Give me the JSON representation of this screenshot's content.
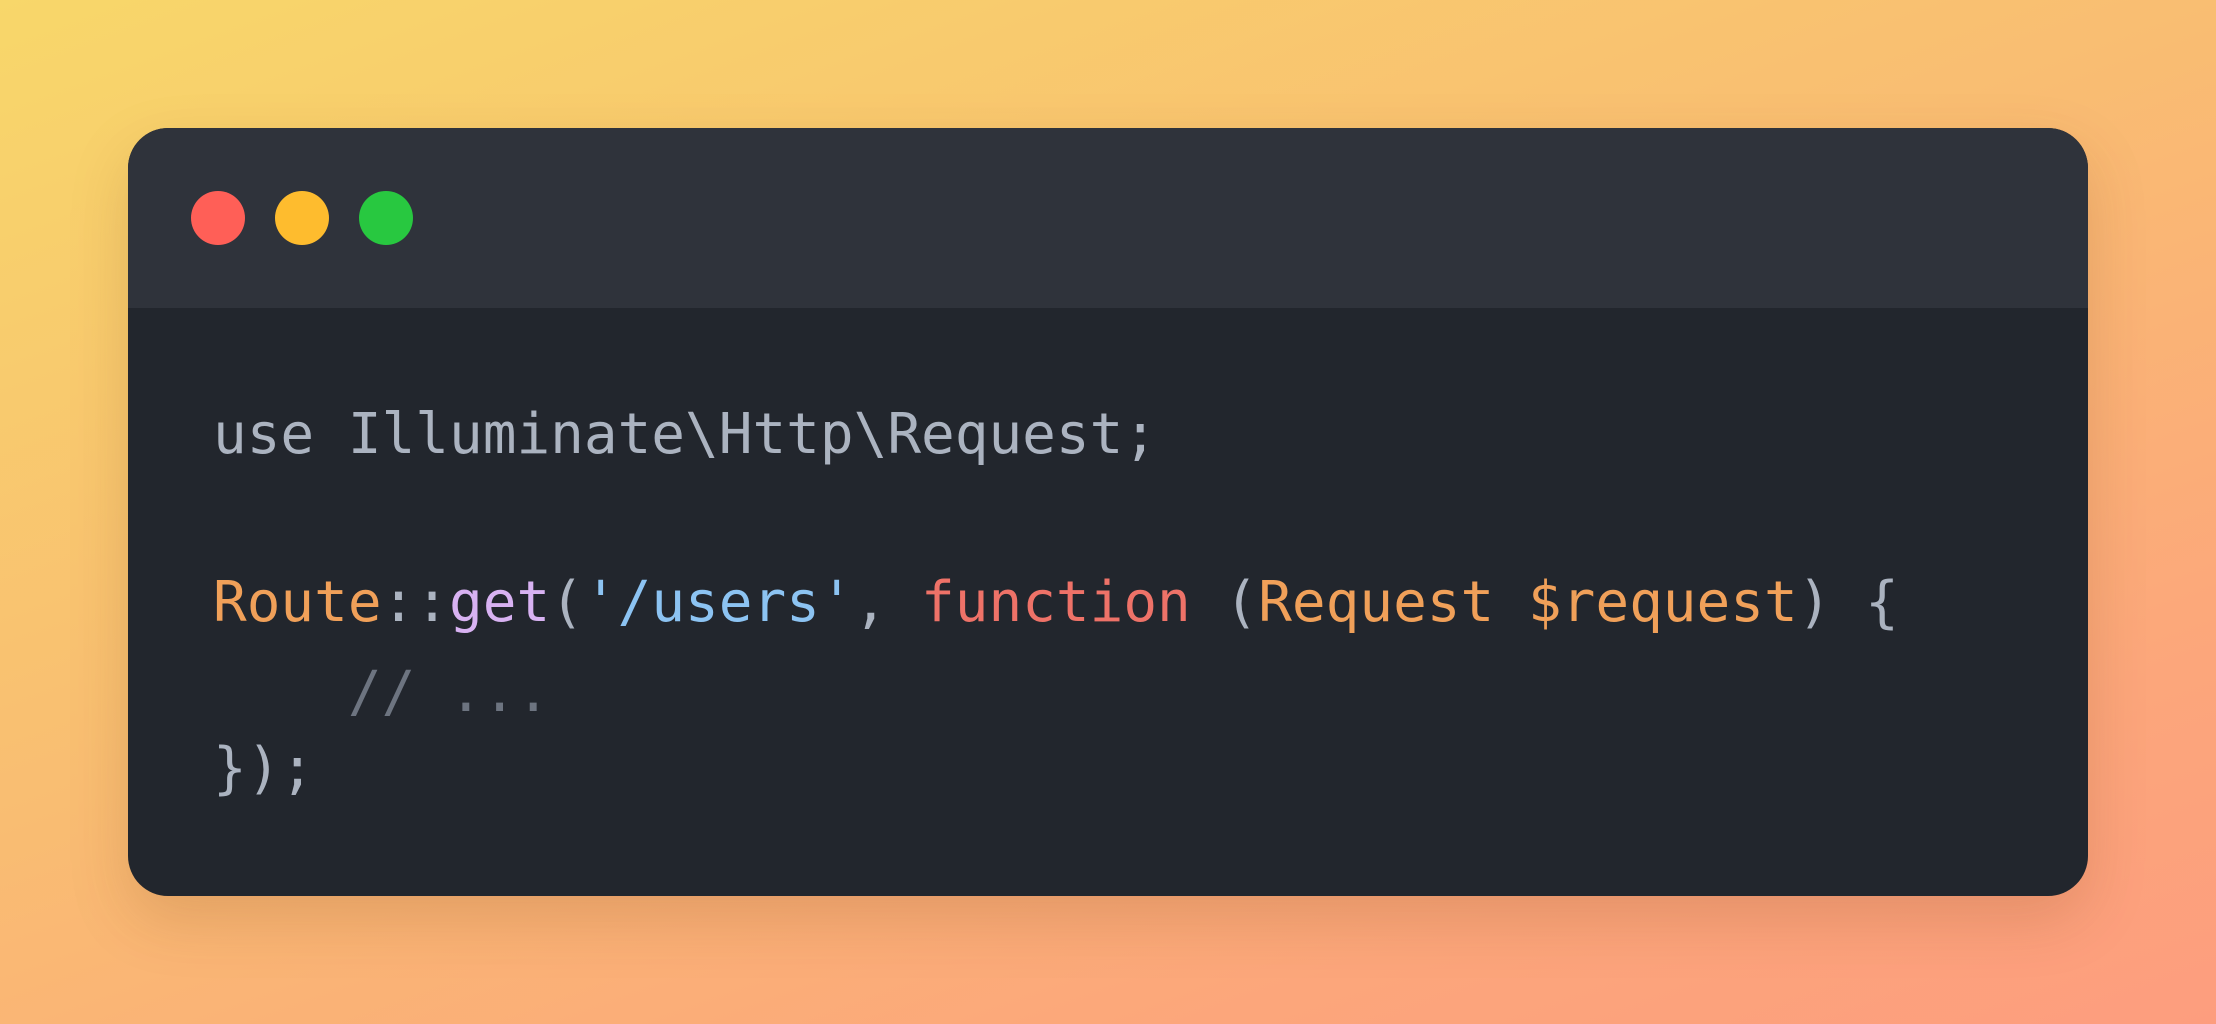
{
  "window": {
    "controls": [
      {
        "name": "close",
        "color": "#ff5f57"
      },
      {
        "name": "minimize",
        "color": "#febc2e"
      },
      {
        "name": "maximize",
        "color": "#28c840"
      }
    ]
  },
  "code": {
    "line1": {
      "kw_use": "use",
      "space": " ",
      "namespace": "Illuminate\\Http\\Request",
      "semicolon": ";"
    },
    "line3": {
      "class": "Route",
      "scope": "::",
      "method": "get",
      "paren_open": "(",
      "string": "'/users'",
      "comma": ", ",
      "kw_function": "function",
      "space": " ",
      "paren_open2": "(",
      "type": "Request",
      "space2": " ",
      "var": "$request",
      "paren_close": ")",
      "brace": " {"
    },
    "line4": {
      "indent": "    ",
      "comment": "// ..."
    },
    "line5": {
      "close": "});"
    }
  },
  "colors": {
    "default": "#abb3c0",
    "orange": "#f0a059",
    "purple": "#d8b2f2",
    "blue": "#8cc3f2",
    "red": "#ee7268",
    "comment": "#6d7480"
  }
}
